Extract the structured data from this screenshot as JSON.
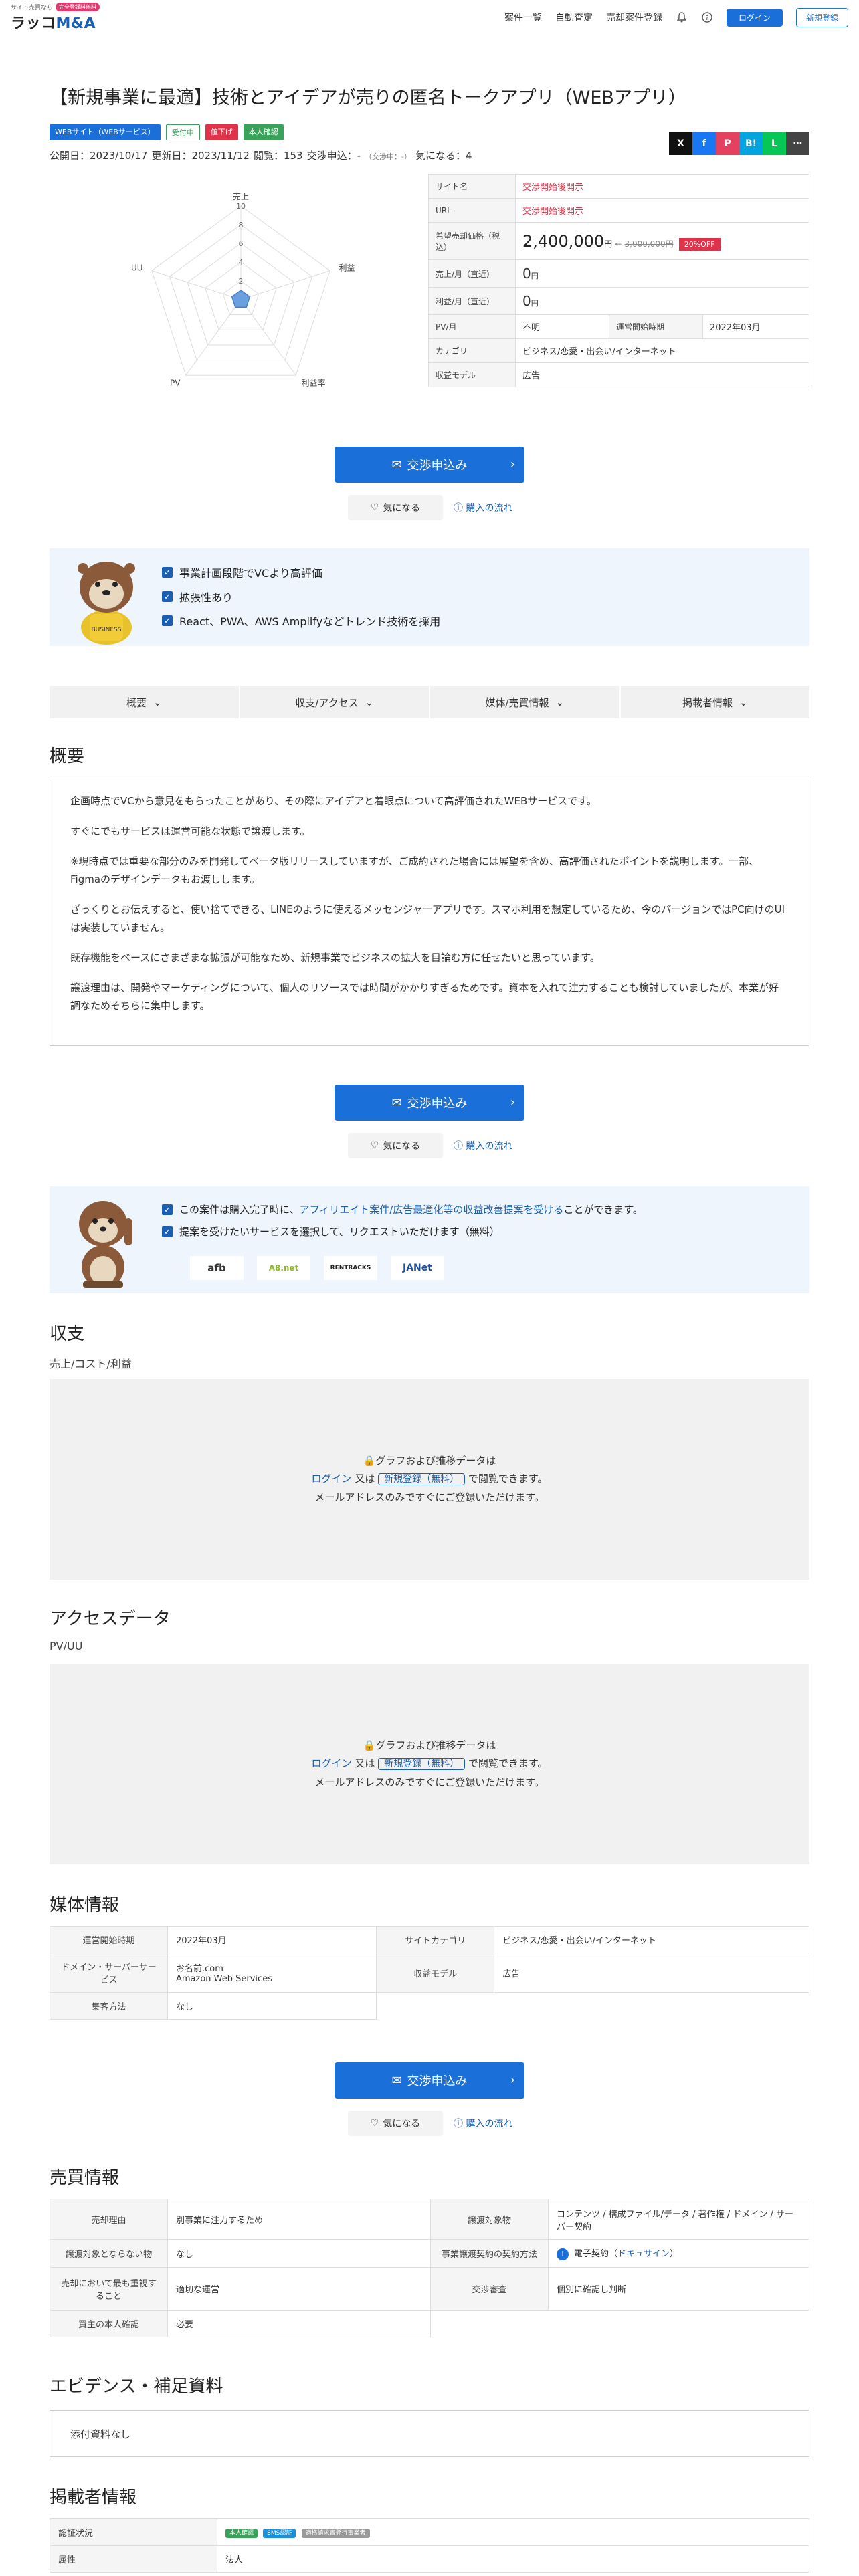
{
  "header": {
    "logo_tagline": "サイト売買なら",
    "logo_badge": "完全登録料無料",
    "logo_name_a": "ラッコ",
    "logo_name_b": "M&A",
    "nav": [
      "案件一覧",
      "自動査定",
      "売却案件登録"
    ],
    "login": "ログイン",
    "signup": "新規登録",
    "nav_icon_a": "bell-icon",
    "nav_icon_b": "question-icon"
  },
  "listing": {
    "title": "【新規事業に最適】技術とアイデアが売りの匿名トークアプリ（WEBアプリ）",
    "tags": [
      "WEBサイト（WEBサービス）",
      "受付中",
      "値下げ",
      "本人確認"
    ],
    "meta_published": "公開日：2023/10/17",
    "meta_updated": "更新日：2023/11/12",
    "meta_views": "閲覧：153",
    "meta_nego": "交渉申込：-",
    "meta_nego_note": "（交渉中：-）",
    "meta_fav": "気になる：4",
    "share": [
      "X",
      "f",
      "P",
      "B!",
      "L",
      "⋯"
    ]
  },
  "radar": {
    "ticks": [
      "10",
      "8",
      "6",
      "4",
      "2"
    ],
    "axes": [
      "売上",
      "利益",
      "利益率",
      "PV",
      "UU"
    ],
    "values": [
      1,
      1,
      1,
      1,
      1
    ],
    "max": 10
  },
  "info": {
    "rows": [
      {
        "label": "サイト名",
        "value": "交渉開始後開示"
      },
      {
        "label": "URL",
        "value": "交渉開始後開示"
      },
      {
        "label": "希望売却価格（税込）",
        "price": "2,400,000",
        "price_unit": "円",
        "old_price": "3,000,000円",
        "off": "20%OFF"
      },
      {
        "label": "売上/月（直近）",
        "value": "0",
        "unit": "円"
      },
      {
        "label": "利益/月（直近）",
        "value": "0",
        "unit": "円"
      },
      {
        "label": "PV/月",
        "value": "不明",
        "label2": "運営開始時期",
        "value2": "2022年03月"
      },
      {
        "label": "カテゴリ",
        "value": "ビジネス/恋愛・出会い/インターネット"
      },
      {
        "label": "収益モデル",
        "value": "広告"
      }
    ]
  },
  "cta": {
    "label": "交渉申込み",
    "fav": "気になる",
    "flow": "購入の流れ"
  },
  "highlights": [
    "事業計画段階でVCより高評価",
    "拡張性あり",
    "React、PWA、AWS Amplifyなどトレンド技術を採用"
  ],
  "tabs": [
    "概要",
    "収支/アクセス",
    "媒体/売買情報",
    "掲載者情報"
  ],
  "overview": {
    "heading": "概要",
    "paragraphs": [
      "企画時点でVCから意見をもらったことがあり、その際にアイデアと着眼点について高評価されたWEBサービスです。",
      "すぐにでもサービスは運営可能な状態で譲渡します。",
      "※現時点では重要な部分のみを開発してベータ版リリースしていますが、ご成約された場合には展望を含め、高評価されたポイントを説明します。一部、Figmaのデザインデータもお渡しします。",
      "ざっくりとお伝えすると、使い捨てできる、LINEのように使えるメッセンジャーアプリです。スマホ利用を想定しているため、今のバージョンではPC向けのUIは実装していません。",
      "既存機能をベースにさまざまな拡張が可能なため、新規事業でビジネスの拡大を目論む方に任せたいと思っています。",
      "譲渡理由は、開発やマーケティングについて、個人のリソースでは時間がかかりすぎるためです。資本を入れて注力することも検討していましたが、本業が好調なためそちらに集中します。"
    ]
  },
  "affiliate": {
    "line1_a": "この案件は購入完了時に、",
    "line1_link": "アフィリエイト案件/広告最適化等の収益改善提案を受ける",
    "line1_b": "ことができます。",
    "line2": "提案を受けたいサービスを選択して、リクエストいただけます（無料）",
    "logos": [
      "afb",
      "A8.net",
      "RENTRACKS",
      "JANet"
    ]
  },
  "finance": {
    "heading": "収支",
    "sub": "売上/コスト/利益"
  },
  "access": {
    "heading": "アクセスデータ",
    "sub": "PV/UU"
  },
  "locked": {
    "line1": "グラフおよび推移データは",
    "login": "ログイン",
    "or": "又は",
    "signup": "新規登録（無料）",
    "line2_end": "で閲覧できます。",
    "line3": "メールアドレスのみですぐにご登録いただけます。"
  },
  "media": {
    "heading": "媒体情報",
    "r1_l1": "運営開始時期",
    "r1_v1": "2022年03月",
    "r1_l2": "サイトカテゴリ",
    "r1_v2": "ビジネス/恋愛・出会い/インターネット",
    "r2_l1": "ドメイン・サーバーサービス",
    "r2_v1a": "お名前.com",
    "r2_v1b": "Amazon Web Services",
    "r2_l2": "収益モデル",
    "r2_v2": "広告",
    "r3_l1": "集客方法",
    "r3_v1": "なし"
  },
  "deal": {
    "heading": "売買情報",
    "r1_l1": "売却理由",
    "r1_v1": "別事業に注力するため",
    "r1_l2": "譲渡対象物",
    "r1_v2": "コンテンツ / 構成ファイル/データ / 著作権 / ドメイン / サーバー契約",
    "r2_l1": "譲渡対象とならない物",
    "r2_v1": "なし",
    "r2_l2": "事業譲渡契約の契約方法",
    "r2_v2": "電子契約",
    "r2_v2_link": "ドキュサイン",
    "r3_l1": "売却において最も重視すること",
    "r3_v1": "適切な運営",
    "r3_l2": "交渉審査",
    "r3_v2": "個別に確認し判断",
    "r4_l1": "買主の本人確認",
    "r4_v1": "必要"
  },
  "evidence": {
    "heading": "エビデンス・補足資料",
    "text": "添付資料なし"
  },
  "seller": {
    "heading": "掲載者情報",
    "r1_label": "認証状況",
    "badges": [
      "本人確認",
      "SMS認証",
      "適格請求書発行事業者"
    ],
    "r2_label": "属性",
    "r2_value": "法人"
  }
}
